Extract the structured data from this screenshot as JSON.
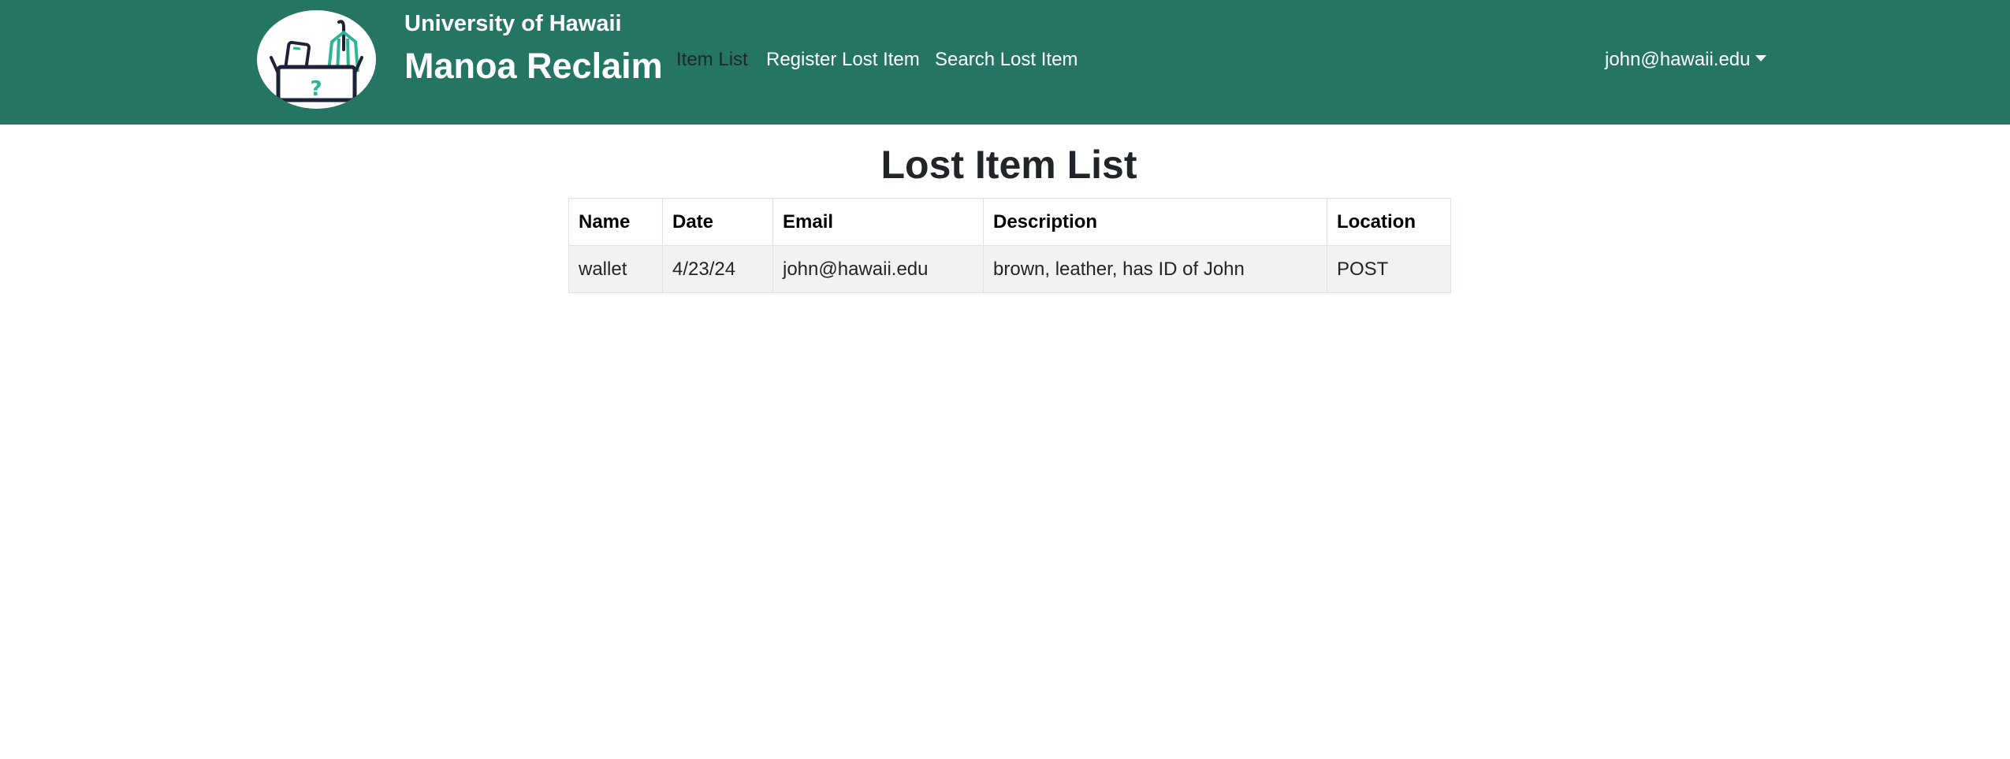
{
  "brand": {
    "university": "University of Hawaii",
    "app_name": "Manoa Reclaim",
    "logo_icon": "lost-and-found-box-icon"
  },
  "nav": {
    "items": [
      {
        "label": "Item List",
        "active": true
      },
      {
        "label": "Register Lost Item",
        "active": false
      },
      {
        "label": "Search Lost Item",
        "active": false
      }
    ],
    "user_email": "john@hawaii.edu"
  },
  "main": {
    "title": "Lost Item List",
    "table": {
      "columns": [
        "Name",
        "Date",
        "Email",
        "Description",
        "Location"
      ],
      "rows": [
        [
          "wallet",
          "4/23/24",
          "john@hawaii.edu",
          "brown, leather, has ID of John",
          "POST"
        ]
      ]
    }
  },
  "colors": {
    "navbar": "#257565",
    "active_link": "#1c2a2c",
    "logo_teal": "#2bb594",
    "logo_dark": "#1d2238"
  }
}
